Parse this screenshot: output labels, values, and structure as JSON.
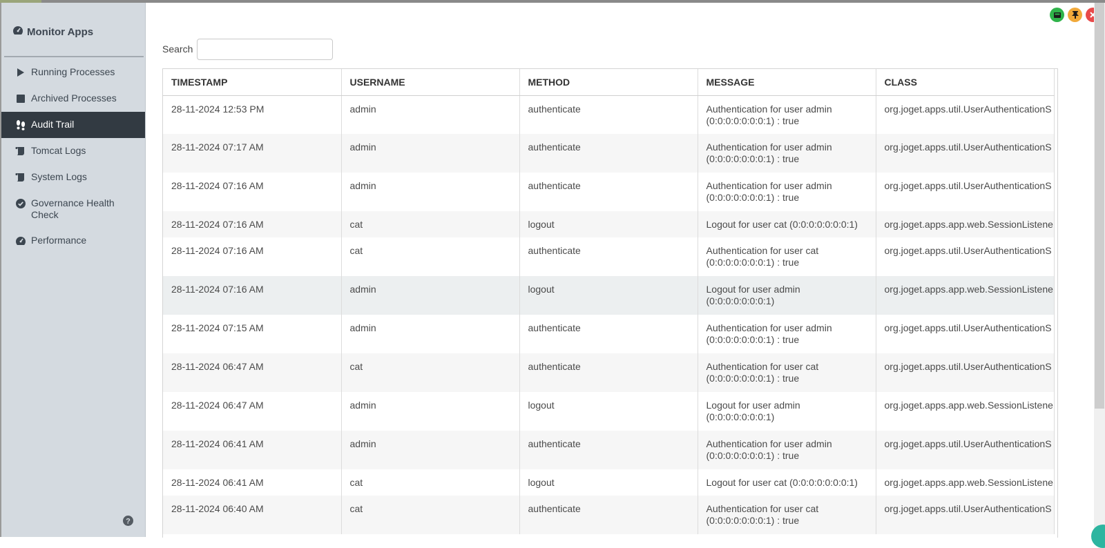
{
  "sidebar": {
    "brand": "Monitor Apps",
    "items": [
      {
        "label": "Running Processes",
        "icon": "play-icon"
      },
      {
        "label": "Archived Processes",
        "icon": "stop-square-icon"
      },
      {
        "label": "Audit Trail",
        "icon": "footprints-icon",
        "active": true
      },
      {
        "label": "Tomcat Logs",
        "icon": "scroll-icon"
      },
      {
        "label": "System Logs",
        "icon": "scroll-icon"
      },
      {
        "label": "Governance Health Check",
        "icon": "check-circle-icon"
      },
      {
        "label": "Performance",
        "icon": "gauge-icon"
      }
    ]
  },
  "search": {
    "label": "Search",
    "value": ""
  },
  "table": {
    "headers": [
      "TIMESTAMP",
      "USERNAME",
      "METHOD",
      "MESSAGE",
      "CLASS"
    ],
    "rows": [
      [
        "28-11-2024 12:53 PM",
        "admin",
        "authenticate",
        "Authentication for user admin (0:0:0:0:0:0:0:1) : true",
        "org.joget.apps.util.UserAuthenticationS"
      ],
      [
        "28-11-2024 07:17 AM",
        "admin",
        "authenticate",
        "Authentication for user admin (0:0:0:0:0:0:0:1) : true",
        "org.joget.apps.util.UserAuthenticationS"
      ],
      [
        "28-11-2024 07:16 AM",
        "admin",
        "authenticate",
        "Authentication for user admin (0:0:0:0:0:0:0:1) : true",
        "org.joget.apps.util.UserAuthenticationS"
      ],
      [
        "28-11-2024 07:16 AM",
        "cat",
        "logout",
        "Logout for user cat (0:0:0:0:0:0:0:1)",
        "org.joget.apps.app.web.SessionListene"
      ],
      [
        "28-11-2024 07:16 AM",
        "cat",
        "authenticate",
        "Authentication for user cat (0:0:0:0:0:0:0:1) : true",
        "org.joget.apps.util.UserAuthenticationS"
      ],
      [
        "28-11-2024 07:16 AM",
        "admin",
        "logout",
        "Logout for user admin (0:0:0:0:0:0:0:1)",
        "org.joget.apps.app.web.SessionListene"
      ],
      [
        "28-11-2024 07:15 AM",
        "admin",
        "authenticate",
        "Authentication for user admin (0:0:0:0:0:0:0:1) : true",
        "org.joget.apps.util.UserAuthenticationS"
      ],
      [
        "28-11-2024 06:47 AM",
        "cat",
        "authenticate",
        "Authentication for user cat (0:0:0:0:0:0:0:1) : true",
        "org.joget.apps.util.UserAuthenticationS"
      ],
      [
        "28-11-2024 06:47 AM",
        "admin",
        "logout",
        "Logout for user admin (0:0:0:0:0:0:0:1)",
        "org.joget.apps.app.web.SessionListene"
      ],
      [
        "28-11-2024 06:41 AM",
        "admin",
        "authenticate",
        "Authentication for user admin (0:0:0:0:0:0:0:1) : true",
        "org.joget.apps.util.UserAuthenticationS"
      ],
      [
        "28-11-2024 06:41 AM",
        "cat",
        "logout",
        "Logout for user cat (0:0:0:0:0:0:0:1)",
        "org.joget.apps.app.web.SessionListene"
      ],
      [
        "28-11-2024 06:40 AM",
        "cat",
        "authenticate",
        "Authentication for user cat (0:0:0:0:0:0:0:1) : true",
        "org.joget.apps.util.UserAuthenticationS"
      ]
    ]
  },
  "colors": {
    "sidebar_bg": "#d4dae0",
    "active_bg": "#323a42"
  }
}
